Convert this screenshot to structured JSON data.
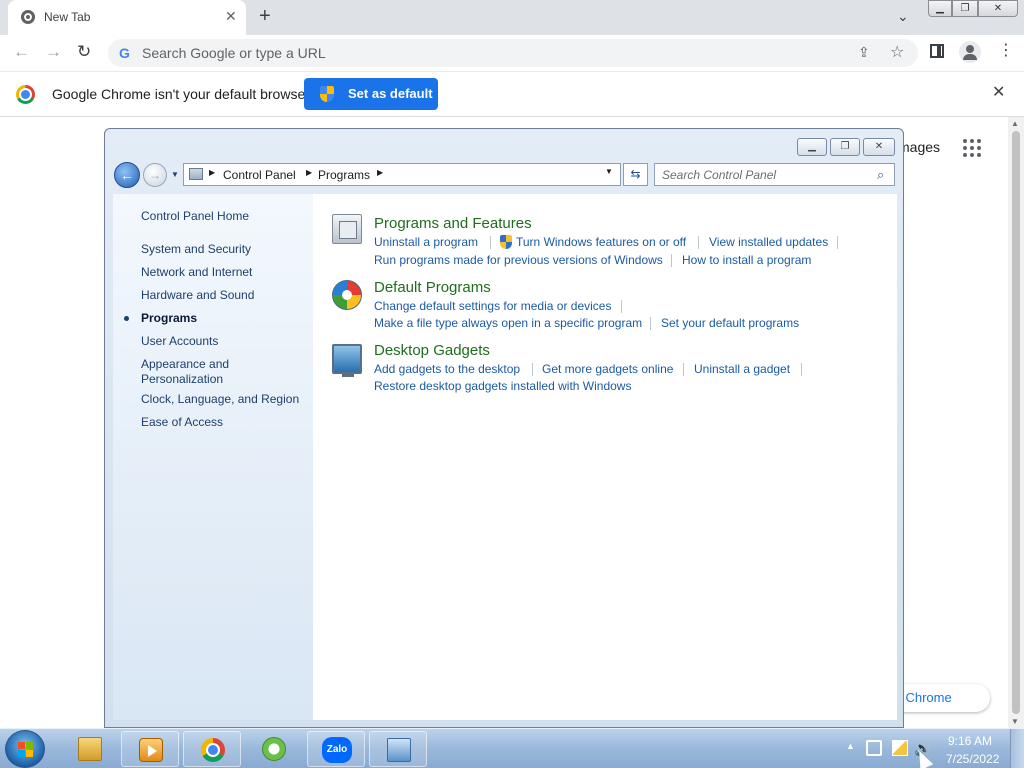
{
  "browser": {
    "tab_title": "New Tab",
    "omnibox_placeholder": "Search Google or type a URL",
    "infobar_message": "Google Chrome isn't your default browser",
    "set_default_label": "Set as default",
    "page_images_label": "mages",
    "customize_label": "nize Chrome",
    "accent_color": "#1a73e8"
  },
  "control_panel": {
    "breadcrumb": [
      "Control Panel",
      "Programs"
    ],
    "search_placeholder": "Search Control Panel",
    "nav": {
      "home": "Control Panel Home",
      "items": [
        "System and Security",
        "Network and Internet",
        "Hardware and Sound",
        "Programs",
        "User Accounts",
        "Appearance and\nPersonalization",
        "Clock, Language, and Region",
        "Ease of Access"
      ],
      "current": "Programs"
    },
    "categories": [
      {
        "title": "Programs and Features",
        "links": [
          "Uninstall a program",
          "Turn Windows features on or off",
          "View installed updates",
          "Run programs made for previous versions of Windows",
          "How to install a program"
        ]
      },
      {
        "title": "Default Programs",
        "links": [
          "Change default settings for media or devices",
          "Make a file type always open in a specific program",
          "Set your default programs"
        ]
      },
      {
        "title": "Desktop Gadgets",
        "links": [
          "Add gadgets to the desktop",
          "Get more gadgets online",
          "Uninstall a gadget",
          "Restore desktop gadgets installed with Windows"
        ]
      }
    ],
    "category_title_color": "#1e6e1e",
    "link_color": "#1c5aa6"
  },
  "taskbar": {
    "zalo_label": "Zalo",
    "time": "9:16 AM",
    "date": "7/25/2022"
  }
}
